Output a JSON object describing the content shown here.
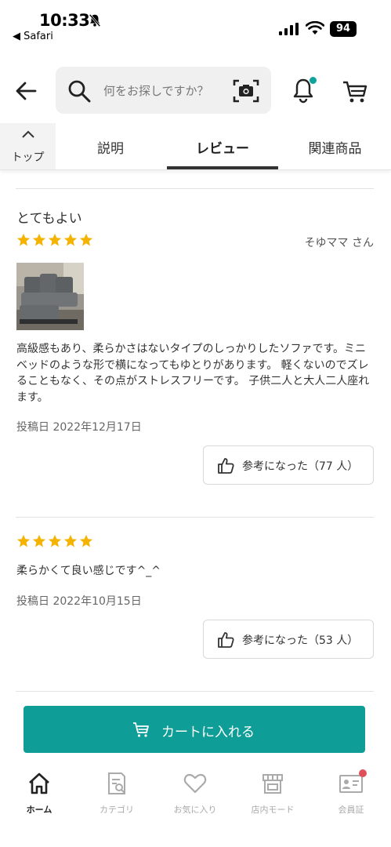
{
  "status_bar": {
    "time": "10:33",
    "back_app": "◀ Safari",
    "battery": "94"
  },
  "header": {
    "search_placeholder": "何をお探しですか？",
    "icons": [
      "back-arrow-icon",
      "search-icon",
      "camera-search-icon",
      "bell-icon",
      "cart-icon"
    ]
  },
  "tabs": {
    "top_label": "トップ",
    "items": [
      {
        "label": "説明"
      },
      {
        "label": "レビュー",
        "active": true
      },
      {
        "label": "関連商品"
      }
    ]
  },
  "reviews": [
    {
      "title": "とてもよい",
      "stars": 5,
      "reviewer": "そゆママ さん",
      "body": "高級感もあり、柔らかさはないタイプのしっかりしたソファです。ミニベッドのような形で横になってもゆとりがあります。 軽くないのでズレることもなく、その点がストレスフリーです。 子供二人と大人二人座れます。",
      "date": "投稿日 2022年12月17日",
      "helpful": "参考になった（77 人）"
    },
    {
      "title": "",
      "stars": 5,
      "reviewer": "",
      "body": "柔らかくて良い感じです^_^",
      "date": "投稿日 2022年10月15日",
      "helpful": "参考になった（53 人）"
    }
  ],
  "cart_button": {
    "label": "カートに入れる"
  },
  "bottom_nav": [
    {
      "label": "ホーム",
      "icon": "home-icon",
      "active": true
    },
    {
      "label": "カテゴリ",
      "icon": "category-icon"
    },
    {
      "label": "お気に入り",
      "icon": "heart-icon"
    },
    {
      "label": "店内モード",
      "icon": "store-icon"
    },
    {
      "label": "会員証",
      "icon": "member-card-icon"
    }
  ],
  "colors": {
    "accent": "#0f9e97",
    "star": "#f5b301",
    "notification_dot": "#0fa39b",
    "badge_red": "#e0505b"
  }
}
